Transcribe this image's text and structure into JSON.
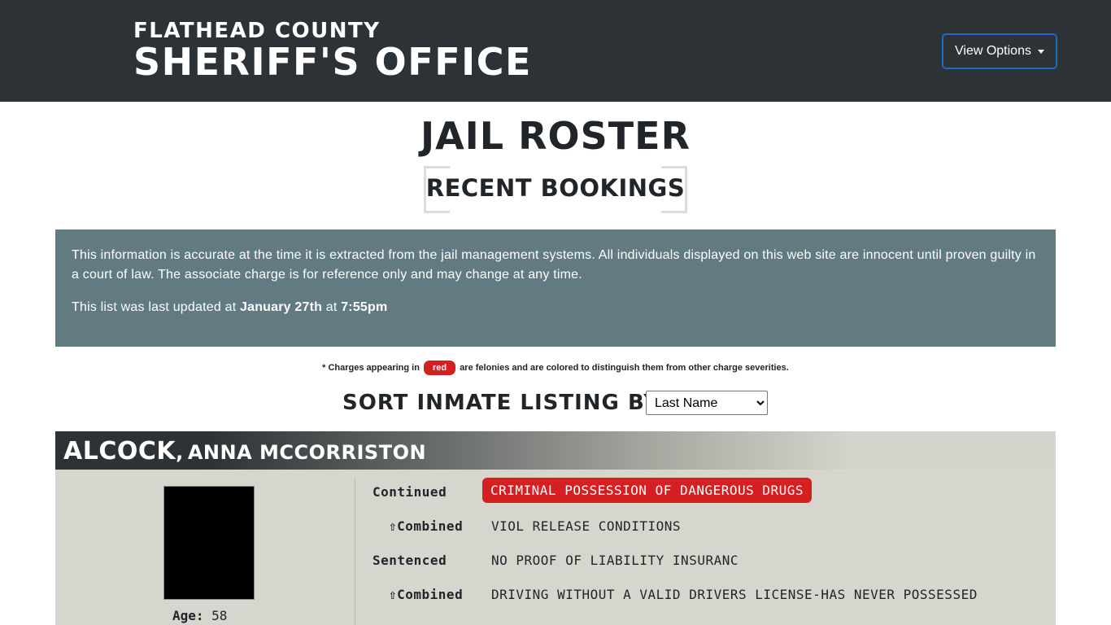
{
  "header": {
    "brand_line1": "FLATHEAD COUNTY",
    "brand_line2": "SHERIFF'S OFFICE",
    "view_options_label": "View Options"
  },
  "page": {
    "title": "JAIL ROSTER",
    "subtitle": "RECENT BOOKINGS"
  },
  "notice": {
    "paragraph": "This information is accurate at the time it is extracted from the jail management systems. All individuals displayed on this web site are innocent until proven guilty in a court of law. The associate charge is for reference only and may change at any time.",
    "updated_prefix": "This list was last updated at",
    "updated_date": "January 27th",
    "updated_at": "at",
    "updated_time": "7:55pm"
  },
  "legend": {
    "prefix": "* Charges appearing in",
    "pill": "red",
    "suffix": "are felonies and are colored to distinguish them from other charge severities."
  },
  "sort": {
    "label": "SORT INMATE LISTING BY:",
    "selected": "Last Name"
  },
  "inmates": [
    {
      "last_name": "ALCOCK",
      "separator": ",",
      "first_name": "ANNA MCCORRISTON",
      "age_label": "Age:",
      "age": "58",
      "charges": [
        {
          "type": "Continued",
          "description": "CRIMINAL POSSESSION OF DANGEROUS DRUGS",
          "felony": true
        },
        {
          "type": "⇧Combined",
          "description": "VIOL RELEASE CONDITIONS",
          "felony": false
        },
        {
          "type": "Sentenced",
          "description": "NO PROOF OF LIABILITY INSURANC",
          "felony": false
        },
        {
          "type": "⇧Combined",
          "description": "DRIVING WITHOUT A VALID DRIVERS LICENSE-HAS NEVER POSSESSED",
          "felony": false
        }
      ]
    }
  ],
  "colors": {
    "header_bg": "#2c3235",
    "notice_bg": "#627a82",
    "felony_red": "#d42020",
    "card_bg": "#d7d6ce"
  }
}
